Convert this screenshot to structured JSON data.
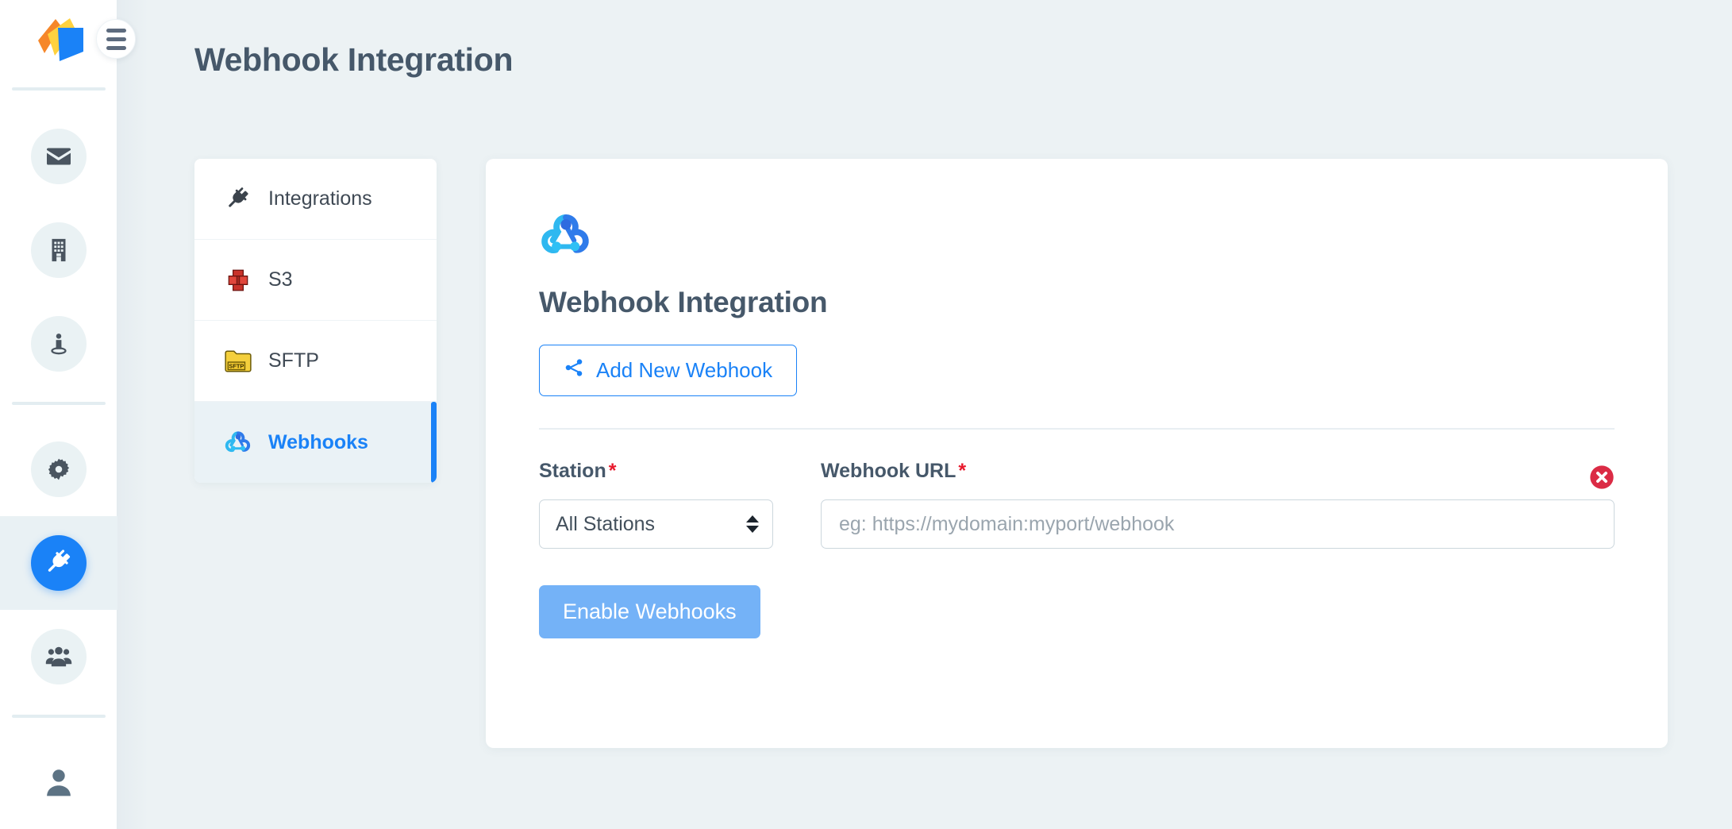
{
  "colors": {
    "accent": "#1a82f7",
    "accent_soft": "#74b2f7",
    "danger": "#e8192c",
    "heading": "#46586a",
    "page_bg": "#ecf2f4",
    "card_bg": "#ffffff"
  },
  "header": {
    "title": "Webhook Integration",
    "menu_toggle": "hamburger-menu"
  },
  "rail": {
    "logo": "app-logo",
    "items": [
      {
        "id": "mail",
        "icon": "envelope-icon",
        "active": false
      },
      {
        "id": "company",
        "icon": "building-icon",
        "active": false
      },
      {
        "id": "stations",
        "icon": "person-pedestal-icon",
        "active": false
      },
      {
        "id": "settings",
        "icon": "gear-icon",
        "active": false
      },
      {
        "id": "integrations",
        "icon": "plug-icon",
        "active": true
      },
      {
        "id": "users",
        "icon": "people-group-icon",
        "active": false
      },
      {
        "id": "account",
        "icon": "user-icon",
        "active": false
      }
    ]
  },
  "tabs": [
    {
      "id": "integrations",
      "label": "Integrations",
      "icon": "plug-icon",
      "active": false
    },
    {
      "id": "s3",
      "label": "S3",
      "icon": "aws-s3-icon",
      "active": false
    },
    {
      "id": "sftp",
      "label": "SFTP",
      "icon": "sftp-folder-icon",
      "active": false
    },
    {
      "id": "webhooks",
      "label": "Webhooks",
      "icon": "webhook-icon",
      "active": true
    }
  ],
  "card": {
    "logo_icon": "webhook-icon",
    "title": "Webhook Integration",
    "add_button": {
      "label": "Add New Webhook",
      "icon": "share-nodes-icon"
    },
    "form": {
      "station": {
        "label": "Station",
        "required_marker": "*",
        "selected": "All Stations",
        "options": [
          "All Stations"
        ]
      },
      "webhook_url": {
        "label": "Webhook URL",
        "required_marker": "*",
        "value": "",
        "placeholder": "eg: https://mydomain:myport/webhook"
      },
      "remove_icon": "remove-circle-icon"
    },
    "submit_button": {
      "label": "Enable Webhooks"
    }
  }
}
